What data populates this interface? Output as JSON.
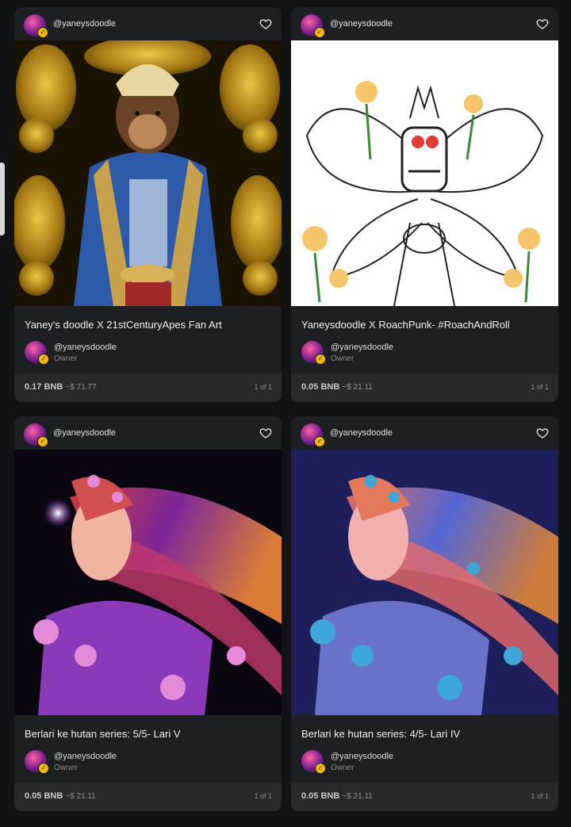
{
  "colors": {
    "background": "#121315",
    "card": "#1e1f22",
    "price_bar": "#28292d",
    "verified": "#f0b90b"
  },
  "cards": [
    {
      "head_user": "@yaneysdoodle",
      "title": "Yaney's doodle X 21stCenturyApes Fan Art",
      "owner_name": "@yaneysdoodle",
      "owner_role": "Owner",
      "price": "0.17 BNB",
      "usd": "~$ 71.77",
      "edition": "1 of 1",
      "heart_icon": "heart-icon"
    },
    {
      "head_user": "@yaneysdoodle",
      "title": "Yaneysdoodle X RoachPunk- #RoachAndRoll",
      "owner_name": "@yaneysdoodle",
      "owner_role": "Owner",
      "price": "0.05 BNB",
      "usd": "~$ 21.11",
      "edition": "1 of 1",
      "heart_icon": "heart-icon"
    },
    {
      "head_user": "@yaneysdoodle",
      "title": "Berlari ke hutan series: 5/5- Lari V",
      "owner_name": "@yaneysdoodle",
      "owner_role": "Owner",
      "price": "0.05 BNB",
      "usd": "~$ 21.11",
      "edition": "1 of 1",
      "heart_icon": "heart-icon"
    },
    {
      "head_user": "@yaneysdoodle",
      "title": "Berlari ke hutan series: 4/5- Lari IV",
      "owner_name": "@yaneysdoodle",
      "owner_role": "Owner",
      "price": "0.05 BNB",
      "usd": "~$ 21.11",
      "edition": "1 of 1",
      "heart_icon": "heart-icon"
    }
  ]
}
